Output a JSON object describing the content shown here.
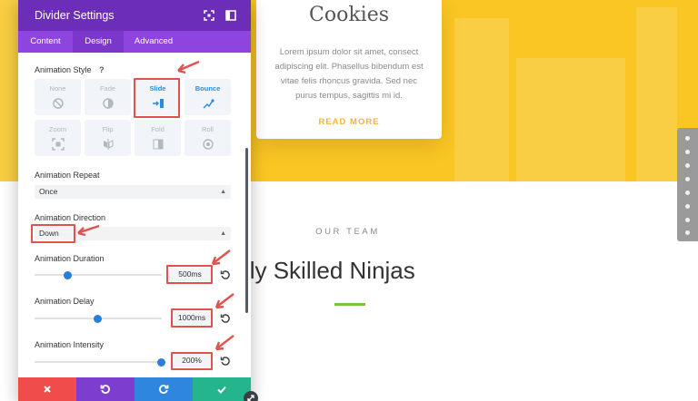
{
  "colors": {
    "accent_purple": "#6c2eb9",
    "tab_purple": "#8e45df",
    "hero_yellow": "#f9c623",
    "highlight_red": "#e0524d",
    "slider_blue": "#2a7dd8",
    "discard_red": "#ef4c4b",
    "undo_purple": "#7d3ed0",
    "redo_blue": "#2f86dd",
    "save_green": "#25b58d",
    "rule_green": "#7cc242"
  },
  "background": {
    "card": {
      "title": "Cookies",
      "body": "Lorem ipsum dolor sit amet, consect adipiscing elit. Phasellus bibendum est vitae felis rhoncus gravida. Sed nec purus tempus, sagittis mi id.",
      "link": "READ MORE"
    },
    "team": {
      "kicker": "OUR TEAM",
      "heading": "ighly Skilled Ninjas"
    },
    "dot_nav_count": 8
  },
  "modal": {
    "title": "Divider Settings",
    "header_icons": [
      "fullscreen-icon",
      "sidebar-toggle-icon"
    ],
    "tabs": [
      {
        "label": "Content",
        "active": false
      },
      {
        "label": "Design",
        "active": true
      },
      {
        "label": "Advanced",
        "active": false
      }
    ],
    "animation_style": {
      "label": "Animation Style",
      "help": "?",
      "options": [
        {
          "name": "None",
          "icon": "none-icon",
          "selected": false
        },
        {
          "name": "Fade",
          "icon": "fade-icon",
          "selected": false
        },
        {
          "name": "Slide",
          "icon": "slide-icon",
          "selected": true
        },
        {
          "name": "Bounce",
          "icon": "bounce-icon",
          "selected": false
        },
        {
          "name": "Zoom",
          "icon": "zoom-icon",
          "selected": false
        },
        {
          "name": "Flip",
          "icon": "flip-icon",
          "selected": false
        },
        {
          "name": "Fold",
          "icon": "fold-icon",
          "selected": false
        },
        {
          "name": "Roll",
          "icon": "roll-icon",
          "selected": false
        }
      ]
    },
    "animation_repeat": {
      "label": "Animation Repeat",
      "value": "Once"
    },
    "animation_direction": {
      "label": "Animation Direction",
      "value": "Down"
    },
    "animation_duration": {
      "label": "Animation Duration",
      "value": "500ms",
      "slider_fraction": 0.26
    },
    "animation_delay": {
      "label": "Animation Delay",
      "value": "1000ms",
      "slider_fraction": 0.49
    },
    "animation_intensity": {
      "label": "Animation Intensity",
      "value": "200%",
      "slider_fraction": 0.99
    },
    "footer": {
      "buttons": [
        {
          "name": "discard",
          "icon": "close-icon"
        },
        {
          "name": "undo",
          "icon": "undo-icon"
        },
        {
          "name": "redo",
          "icon": "redo-icon"
        },
        {
          "name": "save",
          "icon": "check-icon"
        }
      ]
    }
  }
}
